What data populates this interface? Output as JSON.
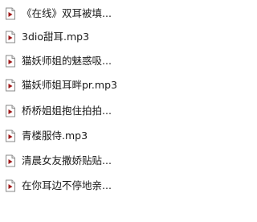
{
  "files": [
    {
      "name": "《在线》双耳被填...",
      "icon": "audio-file-icon"
    },
    {
      "name": "3dio甜耳.mp3",
      "icon": "audio-file-icon"
    },
    {
      "name": "猫妖师姐的魅惑吸...",
      "icon": "audio-file-icon"
    },
    {
      "name": "猫妖师姐耳畔pr.mp3",
      "icon": "audio-file-icon"
    },
    {
      "name": "桥桥姐姐抱住拍拍...",
      "icon": "audio-file-icon"
    },
    {
      "name": "青楼服侍.mp3",
      "icon": "audio-file-icon"
    },
    {
      "name": "清晨女友撒娇贴贴...",
      "icon": "audio-file-icon"
    },
    {
      "name": "在你耳边不停地亲...",
      "icon": "audio-file-icon"
    }
  ],
  "colors": {
    "icon_body": "#ffffff",
    "icon_border": "#8a8a8a",
    "icon_glyph": "#a01818",
    "text": "#1a1a1a"
  }
}
